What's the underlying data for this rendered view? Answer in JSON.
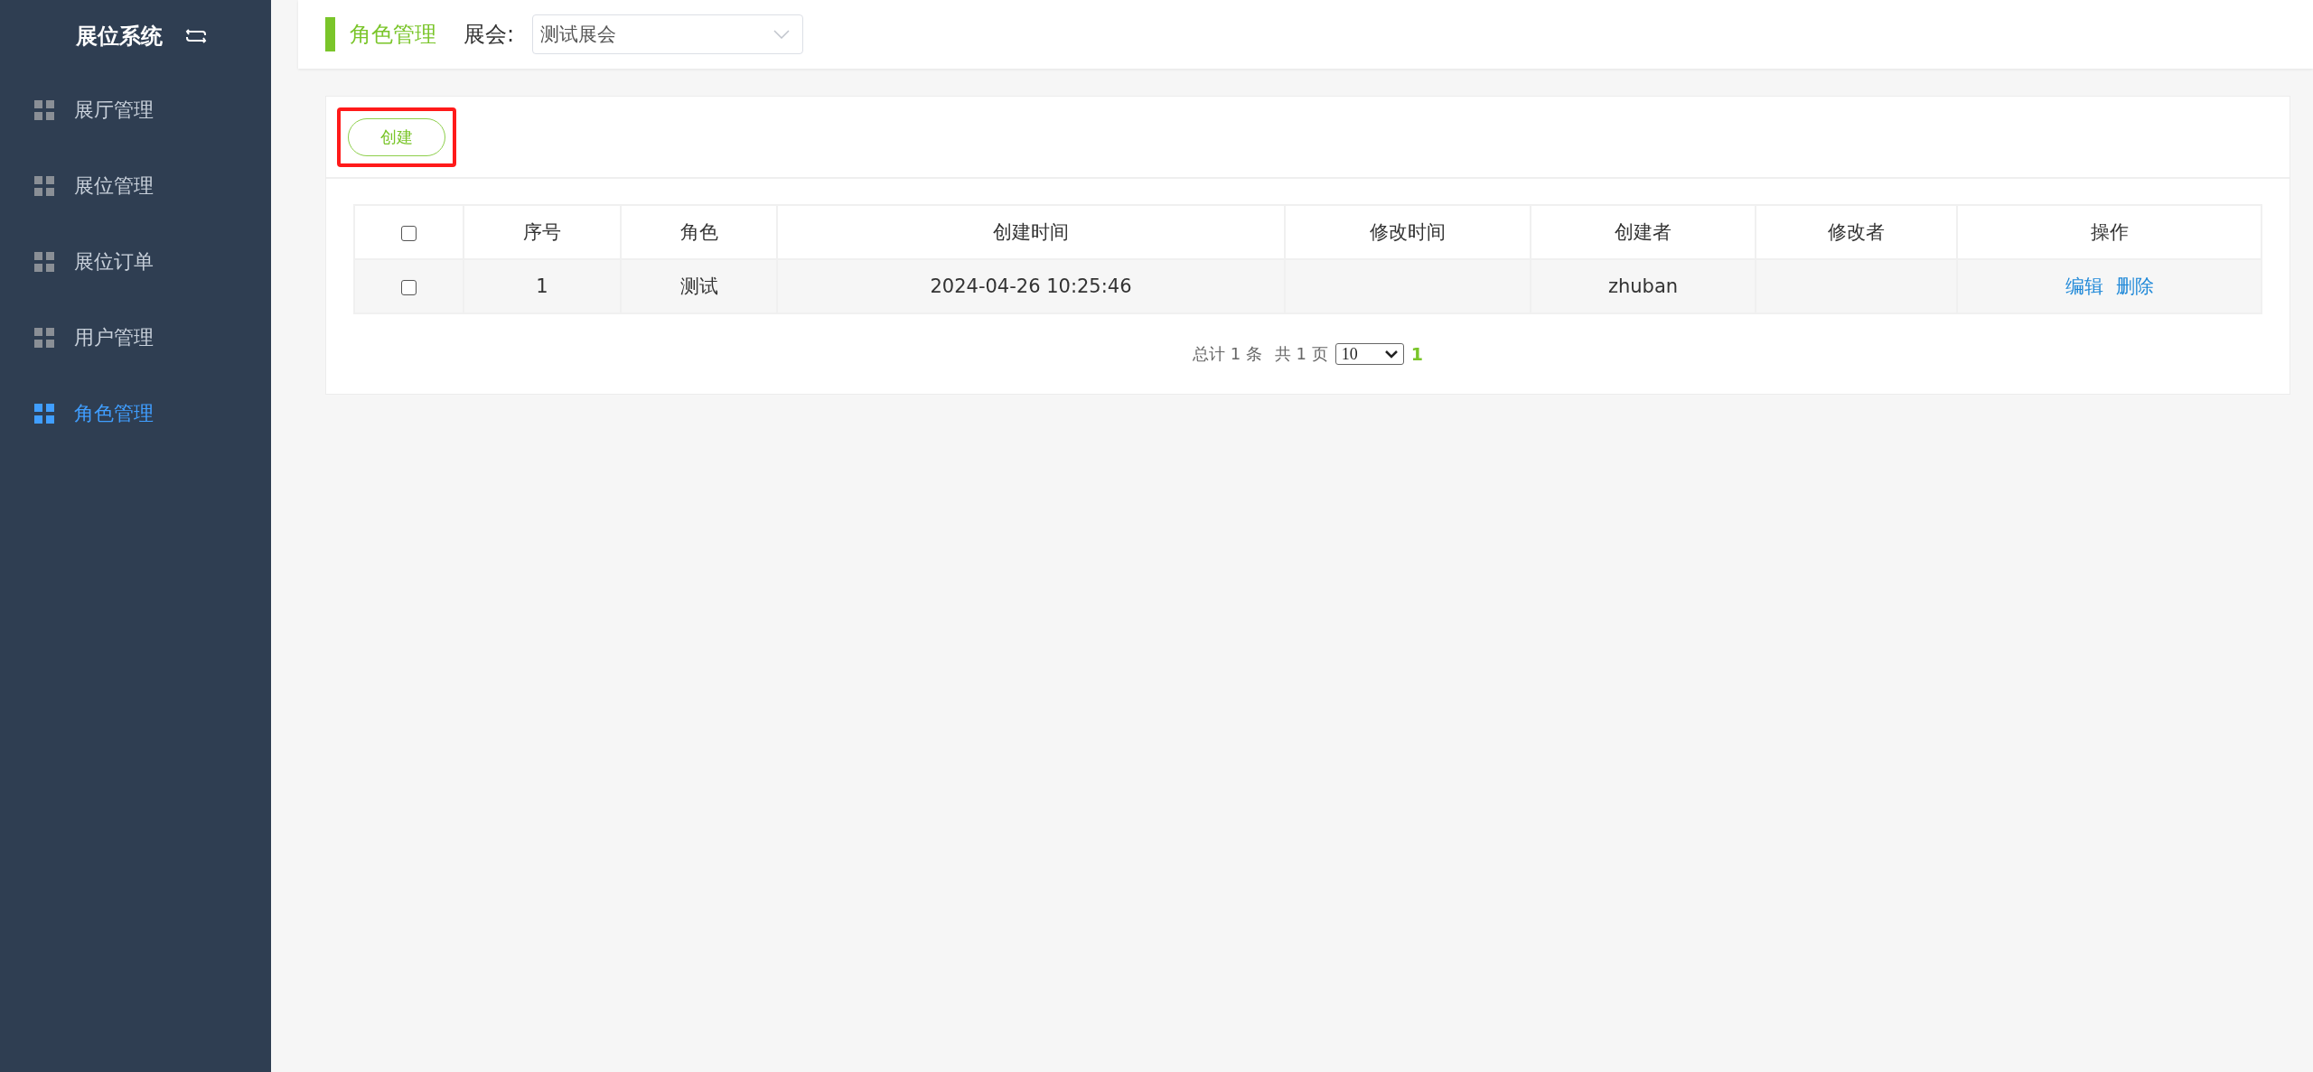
{
  "sidebar": {
    "title": "展位系统",
    "items": [
      {
        "label": "展厅管理",
        "selected": false
      },
      {
        "label": "展位管理",
        "selected": false
      },
      {
        "label": "展位订单",
        "selected": false
      },
      {
        "label": "用户管理",
        "selected": false
      },
      {
        "label": "角色管理",
        "selected": true
      }
    ]
  },
  "header": {
    "page_title": "角色管理",
    "exhibition_label": "展会:",
    "exhibition_value": "测试展会"
  },
  "toolbar": {
    "create_button": "创建",
    "highlighted": true
  },
  "table": {
    "columns": [
      "序号",
      "角色",
      "创建时间",
      "修改时间",
      "创建者",
      "修改者",
      "操作"
    ],
    "header_checked": false,
    "rows": [
      {
        "checked": false,
        "cells": [
          "1",
          "测试",
          "2024-04-26 10:25:46",
          "",
          "zhuban",
          ""
        ],
        "actions": [
          "编辑",
          "删除"
        ]
      }
    ]
  },
  "pagination": {
    "total_prefix": "总计",
    "total": "1",
    "total_suffix": "条",
    "pages_prefix": "共",
    "pages": "1",
    "pages_suffix": "页",
    "page_size": "10",
    "current_page": "1"
  }
}
